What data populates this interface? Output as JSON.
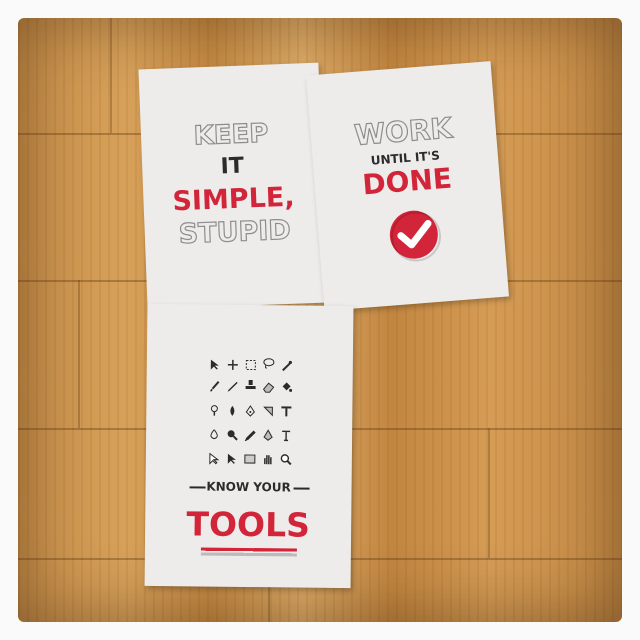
{
  "posters": [
    {
      "id": "keep-it-simple",
      "lines": [
        "KEEP",
        "IT",
        "SIMPLE,",
        "STUPID"
      ]
    },
    {
      "id": "work-until-its-done",
      "lines": [
        "WORK",
        "UNTIL IT'S",
        "DONE"
      ],
      "icon": "check-badge-icon"
    },
    {
      "id": "know-your-tools",
      "lines": [
        "KNOW YOUR",
        "TOOLS"
      ],
      "icon_grid": [
        "pointer-icon",
        "move-icon",
        "marquee-icon",
        "lasso-icon",
        "magic-wand-icon",
        "brush-icon",
        "pencil-icon",
        "clone-stamp-icon",
        "eraser-icon",
        "bucket-icon",
        "dodge-icon",
        "burn-icon",
        "pen-icon",
        "type-icon",
        "path-select-icon",
        "shape-icon",
        "hand-icon",
        "zoom-icon"
      ]
    }
  ],
  "colors": {
    "accent": "#d3253a",
    "paper": "#eeecea",
    "wood": "#d09a52"
  }
}
